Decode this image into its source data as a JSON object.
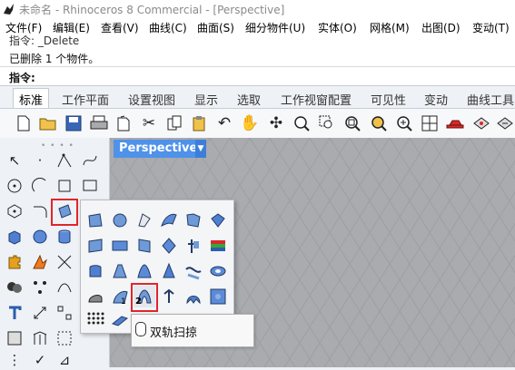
{
  "window": {
    "title": "未命名 - Rhinoceros 8 Commercial - [Perspective]",
    "icon": "rhino-app-icon"
  },
  "menubar": {
    "items": [
      "文件(F)",
      "编辑(E)",
      "查看(V)",
      "曲线(C)",
      "曲面(S)",
      "细分物件(U)",
      "实体(O)",
      "网格(M)",
      "出图(D)",
      "变动(T)"
    ]
  },
  "command_area": {
    "history_line1": "指令: _Delete",
    "history_line2": "已删除 1 个物件。",
    "prompt_label": "指令:"
  },
  "toolbar_tabs": {
    "items": [
      "标准",
      "工作平面",
      "设置视图",
      "显示",
      "选取",
      "工作视窗配置",
      "可见性",
      "变动",
      "曲线工具"
    ],
    "active": "标准"
  },
  "viewport": {
    "label": "Perspective",
    "dropdown_icon": "chevron-down-icon",
    "background": "#a9abae",
    "grid_color": "#9da0a3"
  },
  "flyout": {
    "badge_label": "2",
    "highlight_color": "#e0262b"
  },
  "tooltip": {
    "text": "双轨扫掠",
    "icon": "mouse-icon"
  },
  "colors": {
    "accent": "#4f92ea",
    "highlight": "#e0262b"
  }
}
